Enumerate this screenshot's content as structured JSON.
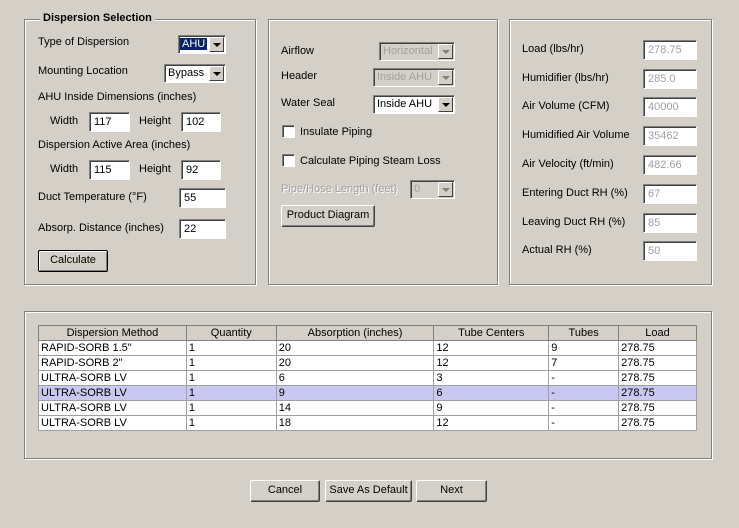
{
  "dispersion_selection": {
    "title": "Dispersion Selection",
    "type_label": "Type of Dispersion",
    "type_value": "AHU",
    "mounting_label": "Mounting Location",
    "mounting_value": "Bypass",
    "ahu_dims_label": "AHU Inside Dimensions (inches)",
    "ahu_width_label": "Width",
    "ahu_width": "117",
    "ahu_height_label": "Height",
    "ahu_height": "102",
    "active_area_label": "Dispersion Active Area (inches)",
    "active_width_label": "Width",
    "active_width": "115",
    "active_height_label": "Height",
    "active_height": "92",
    "duct_temp_label": "Duct Temperature (°F)",
    "duct_temp": "55",
    "absorp_label": "Absorp. Distance (inches)",
    "absorp": "22",
    "calculate_label": "Calculate"
  },
  "piping": {
    "airflow_label": "Airflow",
    "airflow_value": "Horizontal",
    "header_label": "Header",
    "header_value": "Inside AHU",
    "water_seal_label": "Water Seal",
    "water_seal_value": "Inside AHU",
    "insulate_label": "Insulate Piping",
    "steam_loss_label": "Calculate Piping Steam Loss",
    "pipe_length_label": "Pipe/Hose Length (feet)",
    "pipe_length_value": "0",
    "product_diagram_label": "Product Diagram"
  },
  "results": {
    "load_label": "Load (lbs/hr)",
    "load": "278.75",
    "humidifier_label": "Humidifier (lbs/hr)",
    "humidifier": "285.0",
    "air_volume_label": "Air Volume (CFM)",
    "air_volume": "40000",
    "humidified_label": "Humidified Air Volume",
    "humidified": "35462",
    "velocity_label": "Air Velocity (ft/min)",
    "velocity": "482.66",
    "entering_label": "Entering Duct RH (%)",
    "entering": "67",
    "leaving_label": "Leaving Duct RH (%)",
    "leaving": "85",
    "actual_label": "Actual RH (%)",
    "actual": "50"
  },
  "table": {
    "columns": [
      "Dispersion Method",
      "Quantity",
      "Absorption (inches)",
      "Tube Centers",
      "Tubes",
      "Load"
    ],
    "rows": [
      [
        "RAPID-SORB 1.5\"",
        "1",
        "20",
        "12",
        "9",
        "278.75"
      ],
      [
        "RAPID-SORB 2\"",
        "1",
        "20",
        "12",
        "7",
        "278.75"
      ],
      [
        "ULTRA-SORB LV",
        "1",
        "6",
        "3",
        "-",
        "278.75"
      ],
      [
        "ULTRA-SORB LV",
        "1",
        "9",
        "6",
        "-",
        "278.75"
      ],
      [
        "ULTRA-SORB LV",
        "1",
        "14",
        "9",
        "-",
        "278.75"
      ],
      [
        "ULTRA-SORB LV",
        "1",
        "18",
        "12",
        "-",
        "278.75"
      ]
    ],
    "selected_row": 3
  },
  "footer": {
    "cancel_label": "Cancel",
    "save_default_label": "Save As Default",
    "next_label": "Next"
  },
  "colors": {
    "background": "#d4d0c8",
    "selection": "#0a246a",
    "selected_row": "#c8c8f0"
  }
}
